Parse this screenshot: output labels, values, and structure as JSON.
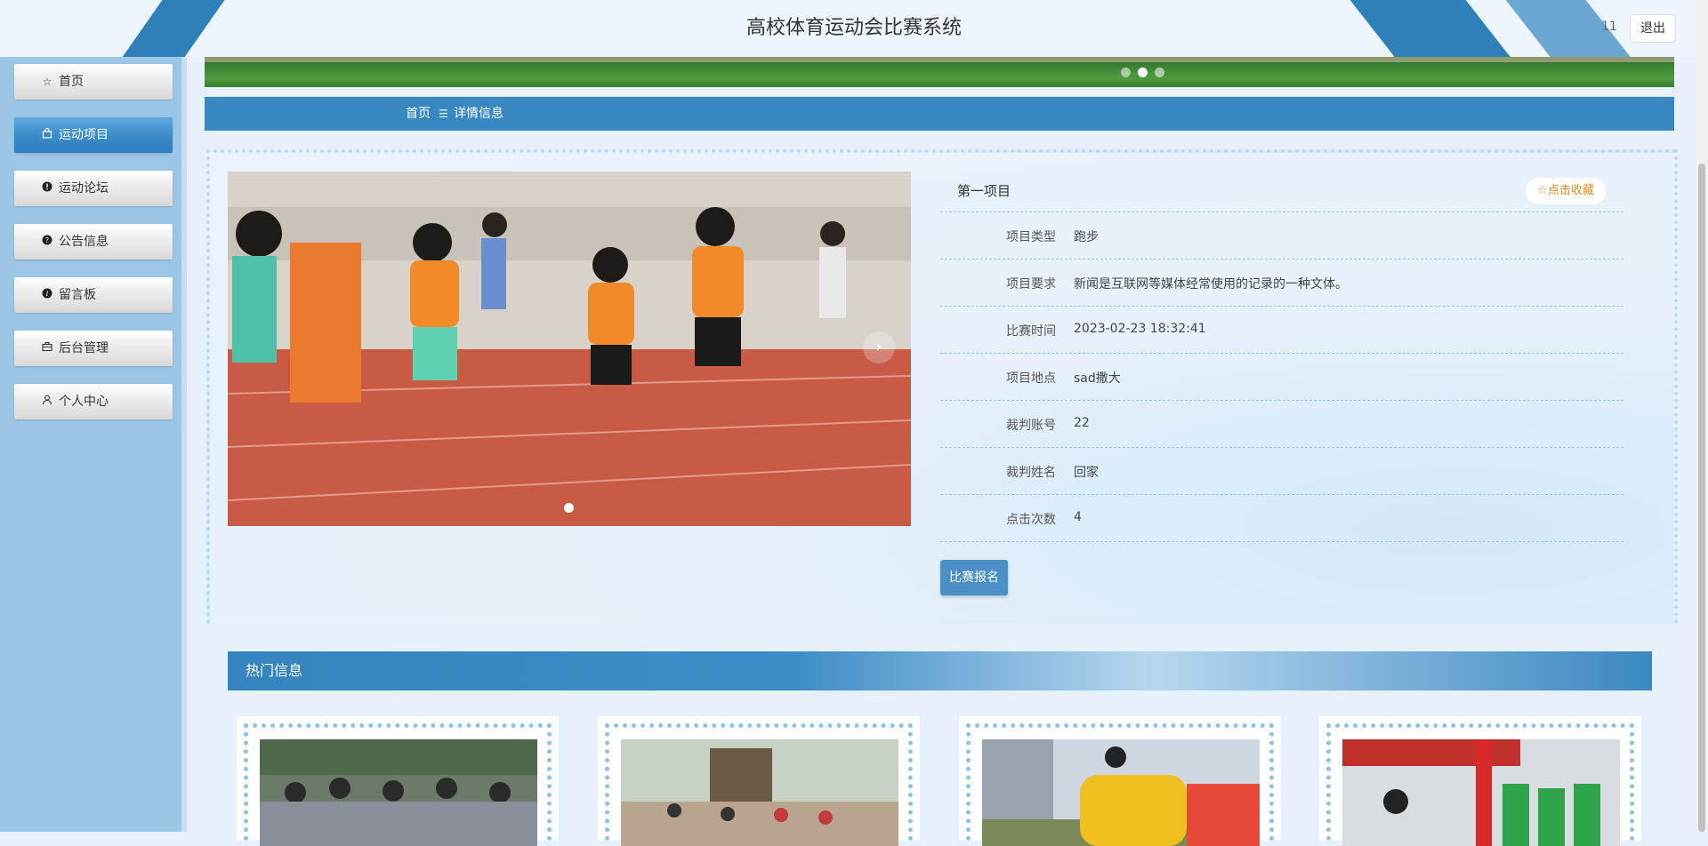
{
  "app": {
    "title": "高校体育运动会比赛系统",
    "user": "11",
    "logout_label": "退出"
  },
  "sidebar": {
    "items": [
      {
        "label": "首页",
        "icon": "star-outline-icon",
        "active": false
      },
      {
        "label": "运动项目",
        "icon": "bag-icon",
        "active": true
      },
      {
        "label": "运动论坛",
        "icon": "exclamation-circle-icon",
        "active": false
      },
      {
        "label": "公告信息",
        "icon": "question-circle-icon",
        "active": false
      },
      {
        "label": "留言板",
        "icon": "info-circle-icon",
        "active": false
      },
      {
        "label": "后台管理",
        "icon": "briefcase-icon",
        "active": false
      },
      {
        "label": "个人中心",
        "icon": "user-icon",
        "active": false
      }
    ]
  },
  "breadcrumb": {
    "home": "首页",
    "current": "详情信息"
  },
  "detail": {
    "name": "第一项目",
    "favorite_label": "☆点击收藏",
    "fields": [
      {
        "label": "项目类型",
        "value": "跑步"
      },
      {
        "label": "项目要求",
        "value": "新闻是互联网等媒体经常使用的记录的一种文体。"
      },
      {
        "label": "比赛时间",
        "value": "2023-02-23 18:32:41"
      },
      {
        "label": "项目地点",
        "value": "sad撒大"
      },
      {
        "label": "裁判账号",
        "value": "22"
      },
      {
        "label": "裁判姓名",
        "value": "回家"
      },
      {
        "label": "点击次数",
        "value": "4"
      }
    ],
    "signup_label": "比赛报名"
  },
  "hot": {
    "title": "热门信息"
  },
  "colors": {
    "primary": "#3a88c1",
    "sidebar": "#9cc6e5",
    "accent": "#e88d1a"
  }
}
